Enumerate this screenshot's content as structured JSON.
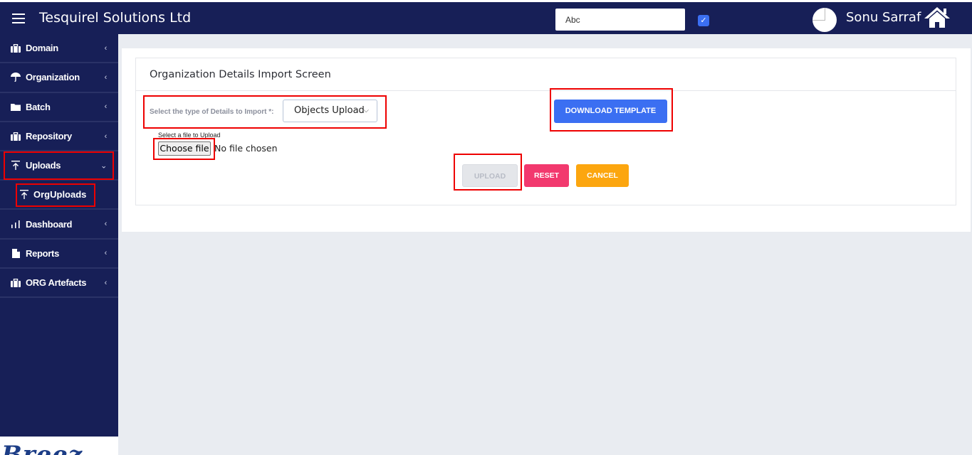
{
  "header": {
    "app_title": "Tesquirel Solutions Ltd",
    "search_value": "Abc",
    "user_name": "Sonu Sarraf"
  },
  "sidebar": {
    "items": [
      {
        "label": "Domain",
        "icon": "briefcase-icon"
      },
      {
        "label": "Organization",
        "icon": "umbrella-icon"
      },
      {
        "label": "Batch",
        "icon": "folder-icon"
      },
      {
        "label": "Repository",
        "icon": "briefcase-icon"
      },
      {
        "label": "Uploads",
        "icon": "upload-icon",
        "expanded": true
      },
      {
        "label": "OrgUploads",
        "icon": "upload-icon",
        "sub": true
      },
      {
        "label": "Dashboard",
        "icon": "bar-chart-icon"
      },
      {
        "label": "Reports",
        "icon": "file-icon"
      },
      {
        "label": "ORG Artefacts",
        "icon": "briefcase-icon"
      }
    ],
    "logo_text": "Breez"
  },
  "main": {
    "screen_title": "Organization Details Import Screen",
    "type_label": "Select the type of Details to Import *:",
    "type_value": "Objects Upload",
    "download_label": "DOWNLOAD TEMPLATE",
    "file_label": "Select a file to Upload",
    "choose_file_label": "Choose file",
    "no_file_text": "No file chosen",
    "upload_label": "UPLOAD",
    "reset_label": "RESET",
    "cancel_label": "CANCEL"
  },
  "colors": {
    "nav_bg": "#171f57",
    "primary": "#3b6ff2",
    "reset": "#f2396e",
    "cancel": "#fca60f",
    "highlight": "#e00000"
  }
}
